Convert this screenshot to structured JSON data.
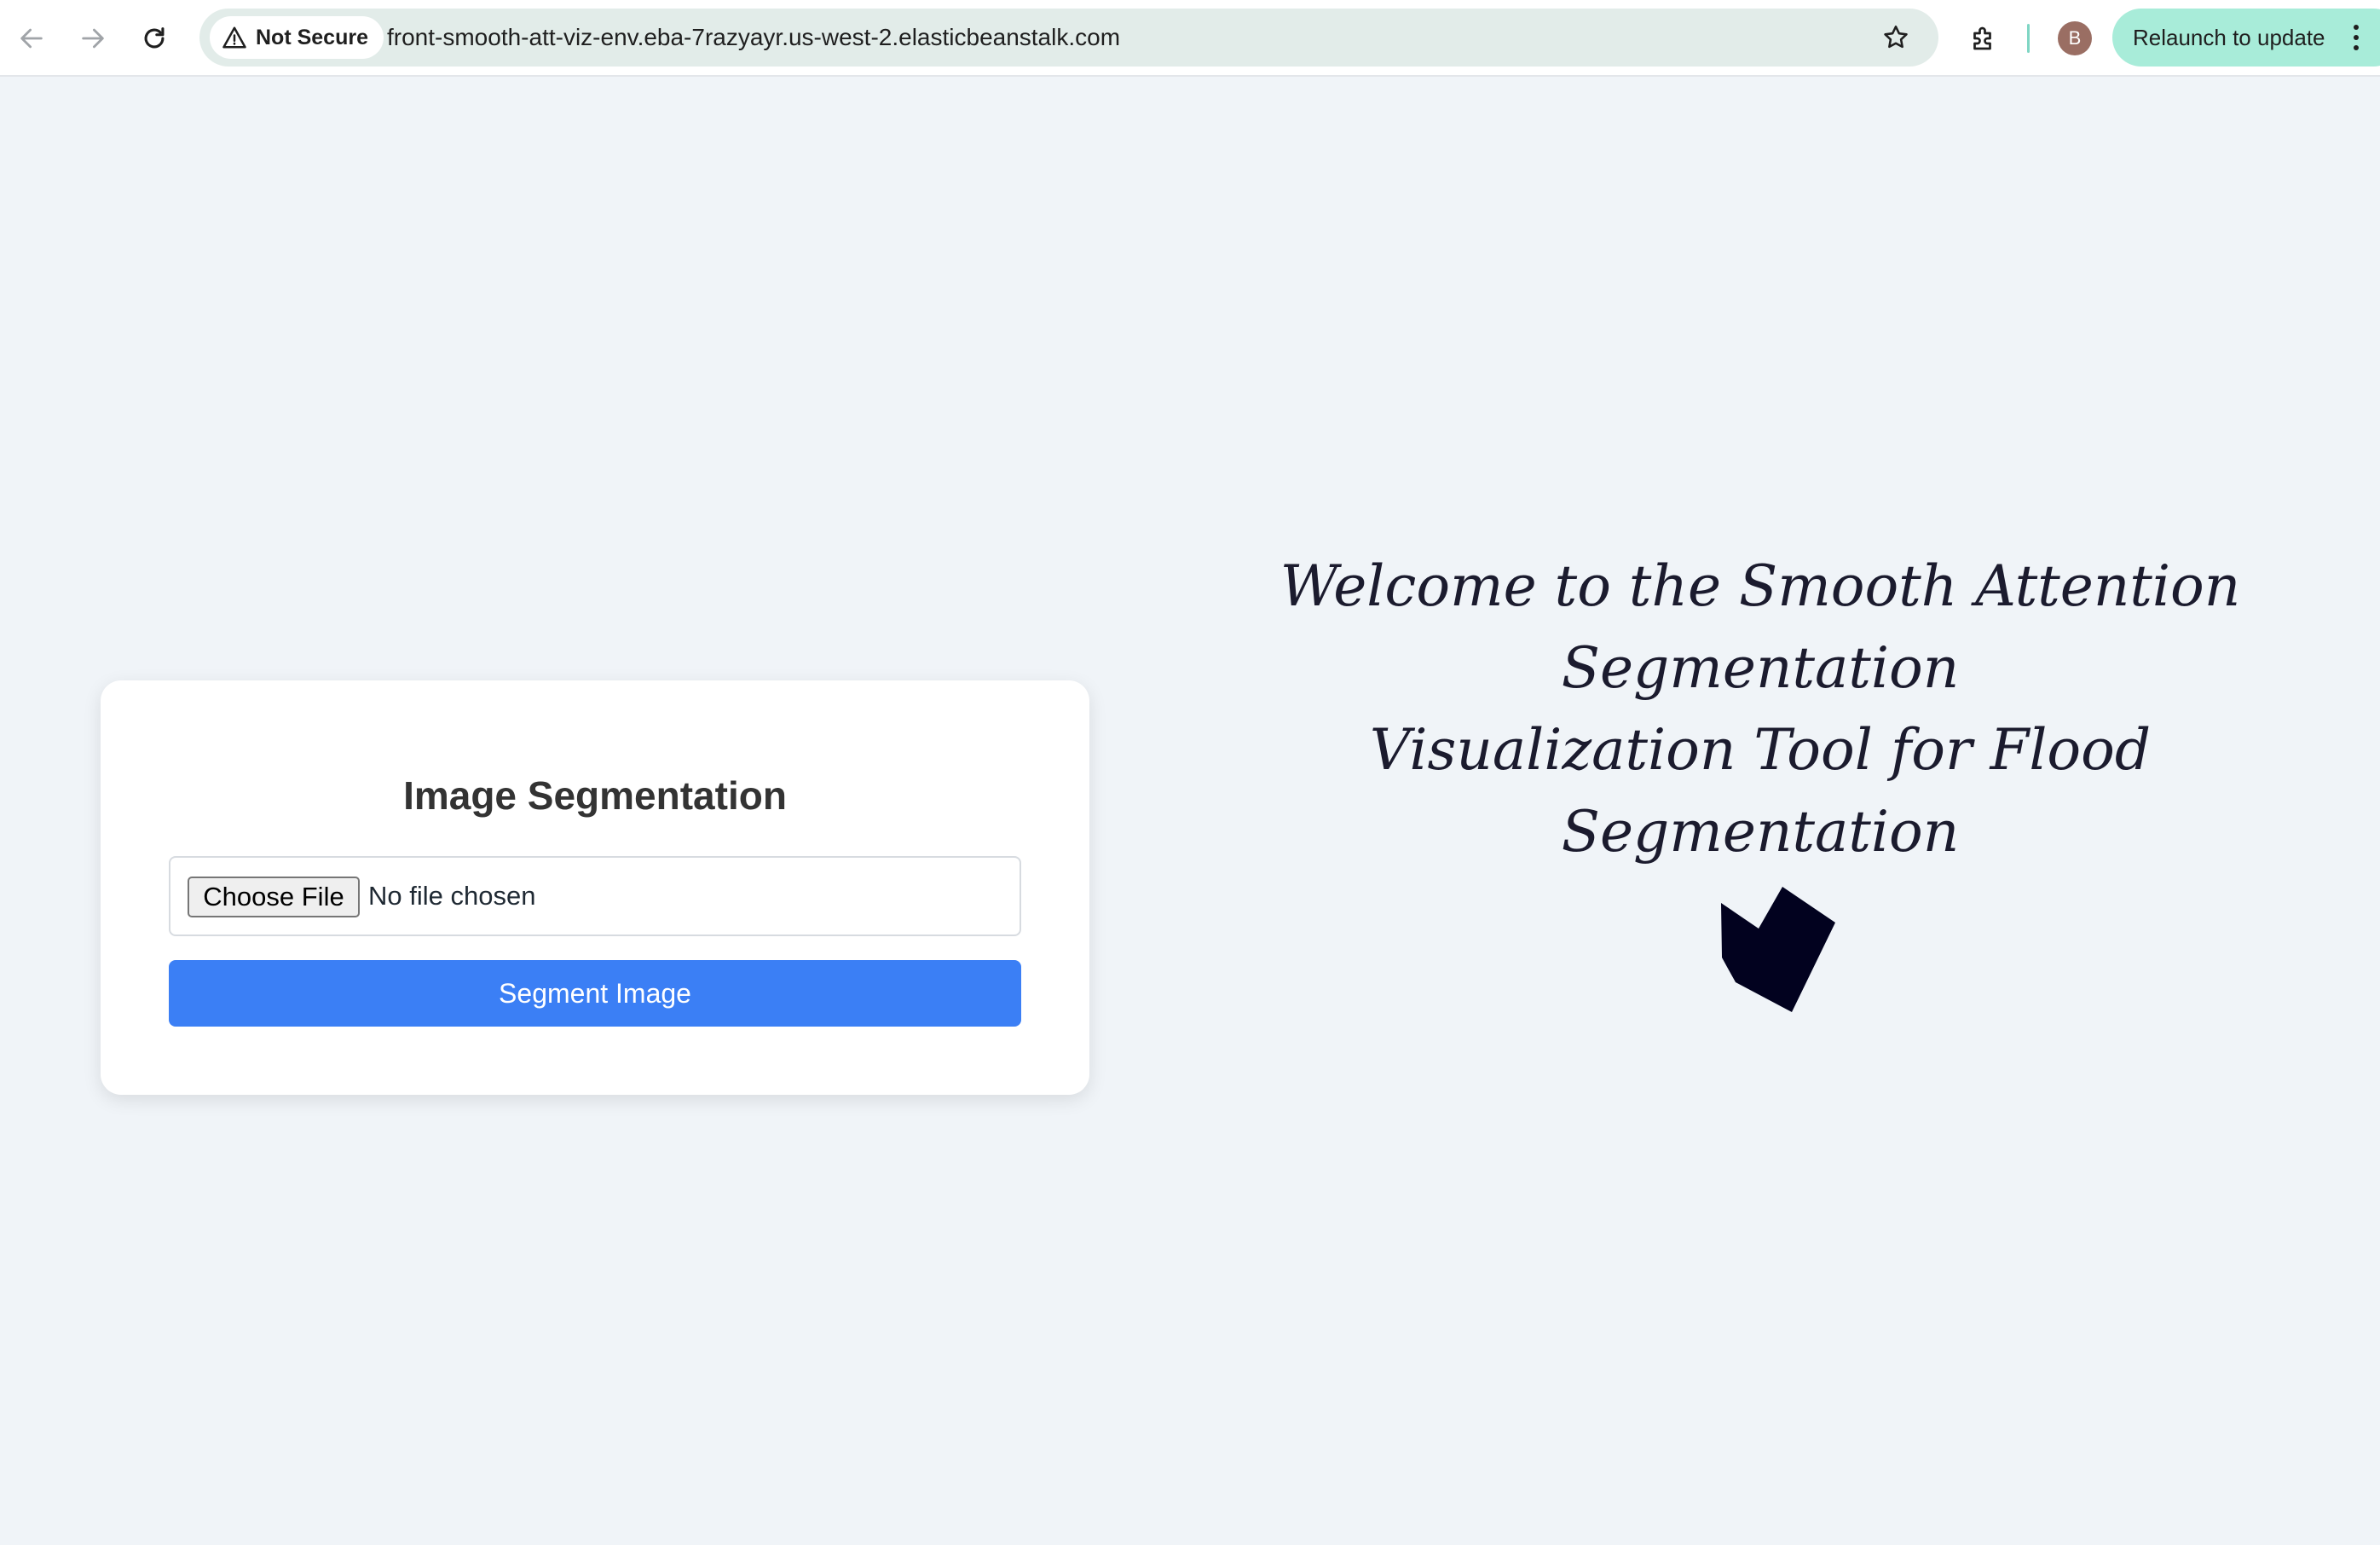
{
  "browser": {
    "security_label": "Not Secure",
    "url": "front-smooth-att-viz-env.eba-7razyayr.us-west-2.elasticbeanstalk.com",
    "avatar_initial": "B",
    "relaunch_label": "Relaunch to update",
    "icons": [
      "back-arrow-icon",
      "forward-arrow-icon",
      "reload-icon",
      "warning-triangle-icon",
      "star-icon",
      "extension-puzzle-icon",
      "menu-dots-icon"
    ]
  },
  "card": {
    "title": "Image Segmentation",
    "choose_file_label": "Choose File",
    "file_status": "No file chosen",
    "submit_label": "Segment Image"
  },
  "welcome": {
    "line1": "Welcome to the Smooth Attention Segmentation",
    "line2": "Visualization Tool for Flood Segmentation"
  },
  "colors": {
    "page_bg": "#f0f4f8",
    "primary_button": "#3b7ff5",
    "cube": "#02021f",
    "relaunch_bg": "#a8ecd9"
  }
}
